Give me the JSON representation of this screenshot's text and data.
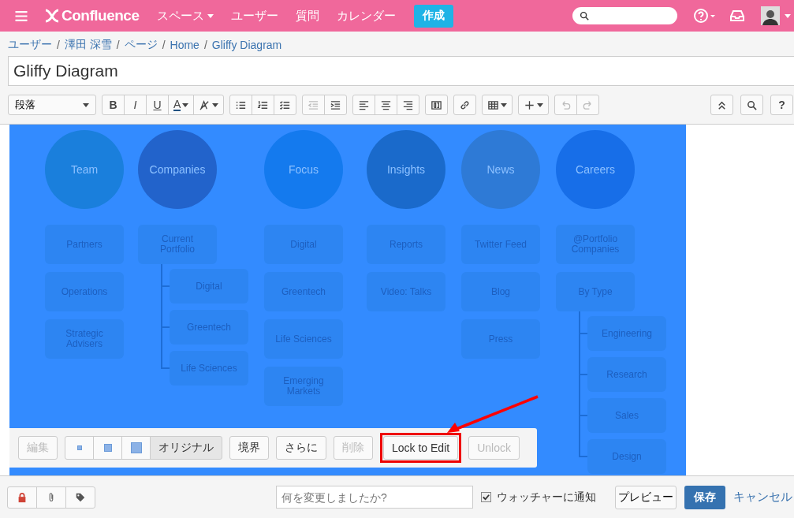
{
  "nav": {
    "logo": "Confluence",
    "menus": [
      {
        "label": "スペース",
        "dropdown": true
      },
      {
        "label": "ユーザー",
        "dropdown": false
      },
      {
        "label": "質問",
        "dropdown": false
      },
      {
        "label": "カレンダー",
        "dropdown": false
      }
    ],
    "create": "作成"
  },
  "breadcrumbs": [
    "ユーザー",
    "澤田 深雪",
    "ページ",
    "Home",
    "Gliffy Diagram"
  ],
  "breadcrumb_separator": "/",
  "title": "Gliffy Diagram",
  "toolbar": {
    "style": "段落",
    "groups": [
      [
        {
          "kind": "text",
          "label": "B",
          "disabled": false
        },
        {
          "kind": "text",
          "label": "I",
          "disabled": false
        },
        {
          "kind": "text",
          "label": "U",
          "disabled": false
        },
        {
          "kind": "color",
          "label": "A",
          "disabled": false
        },
        {
          "kind": "clear",
          "disabled": false
        }
      ],
      [
        {
          "kind": "bullet",
          "disabled": false
        },
        {
          "kind": "number",
          "disabled": false
        },
        {
          "kind": "task",
          "disabled": false
        }
      ],
      [
        {
          "kind": "outdent",
          "disabled": true
        },
        {
          "kind": "indent",
          "disabled": false
        }
      ],
      [
        {
          "kind": "align-left",
          "disabled": false
        },
        {
          "kind": "align-center",
          "disabled": false
        },
        {
          "kind": "align-right",
          "disabled": false
        }
      ],
      [
        {
          "kind": "layout",
          "disabled": false
        }
      ],
      [
        {
          "kind": "link",
          "disabled": false
        }
      ],
      [
        {
          "kind": "table",
          "disabled": false
        }
      ],
      [
        {
          "kind": "insert",
          "disabled": false
        }
      ],
      [
        {
          "kind": "undo",
          "disabled": true
        },
        {
          "kind": "redo",
          "disabled": true
        }
      ]
    ],
    "right": [
      {
        "kind": "collapse"
      },
      {
        "kind": "search"
      },
      {
        "kind": "help",
        "label": "?"
      }
    ]
  },
  "diagram": {
    "columns": [
      {
        "title": "Team",
        "color": "#1a7fdc",
        "items": [
          {
            "label": "Partners"
          },
          {
            "label": "Operations"
          },
          {
            "label": "Strategic Advisers"
          }
        ]
      },
      {
        "title": "Companies",
        "color": "#2263cb",
        "items": [
          {
            "label": "Current Portfolio",
            "children": [
              {
                "label": "Digital"
              },
              {
                "label": "Greentech"
              },
              {
                "label": "Life Sciences"
              }
            ]
          }
        ]
      },
      {
        "title": "Focus",
        "color": "#147aee",
        "items": [
          {
            "label": "Digital"
          },
          {
            "label": "Greentech"
          },
          {
            "label": "Life Sciences"
          },
          {
            "label": "Emerging Markets"
          }
        ]
      },
      {
        "title": "Insights",
        "color": "#1a6acb",
        "items": [
          {
            "label": "Reports"
          },
          {
            "label": "Video: Talks"
          }
        ]
      },
      {
        "title": "News",
        "color": "#2e7ad6",
        "items": [
          {
            "label": "Twitter Feed"
          },
          {
            "label": "Blog"
          },
          {
            "label": "Press"
          }
        ]
      },
      {
        "title": "Careers",
        "color": "#176ee8",
        "items": [
          {
            "label": "@Portfolio Companies"
          },
          {
            "label": "By Type",
            "children": [
              {
                "label": "Engineering"
              },
              {
                "label": "Research"
              },
              {
                "label": "Sales"
              },
              {
                "label": "Design"
              }
            ]
          }
        ]
      }
    ]
  },
  "image_toolbar": [
    {
      "kind": "button",
      "label": "編集",
      "disabled": true,
      "highlighted": false
    },
    {
      "kind": "sizes",
      "options": [
        {
          "kind": "small",
          "selected": false
        },
        {
          "kind": "medium",
          "selected": false
        },
        {
          "kind": "large",
          "selected": false
        },
        {
          "kind": "original",
          "label": "オリジナル",
          "selected": true
        }
      ]
    },
    {
      "kind": "button",
      "label": "境界",
      "disabled": false,
      "highlighted": false
    },
    {
      "kind": "button",
      "label": "さらに",
      "disabled": false,
      "highlighted": false
    },
    {
      "kind": "button",
      "label": "削除",
      "disabled": true,
      "highlighted": false
    },
    {
      "kind": "button",
      "label": "Lock to Edit",
      "disabled": false,
      "highlighted": true
    },
    {
      "kind": "button",
      "label": "Unlock",
      "disabled": true,
      "highlighted": false
    }
  ],
  "footer": {
    "comment_placeholder": "何を変更しましたか?",
    "notify": {
      "label": "ウォッチャーに通知",
      "checked": true
    },
    "preview": "プレビュー",
    "save": "保存",
    "cancel": "キャンセル"
  }
}
